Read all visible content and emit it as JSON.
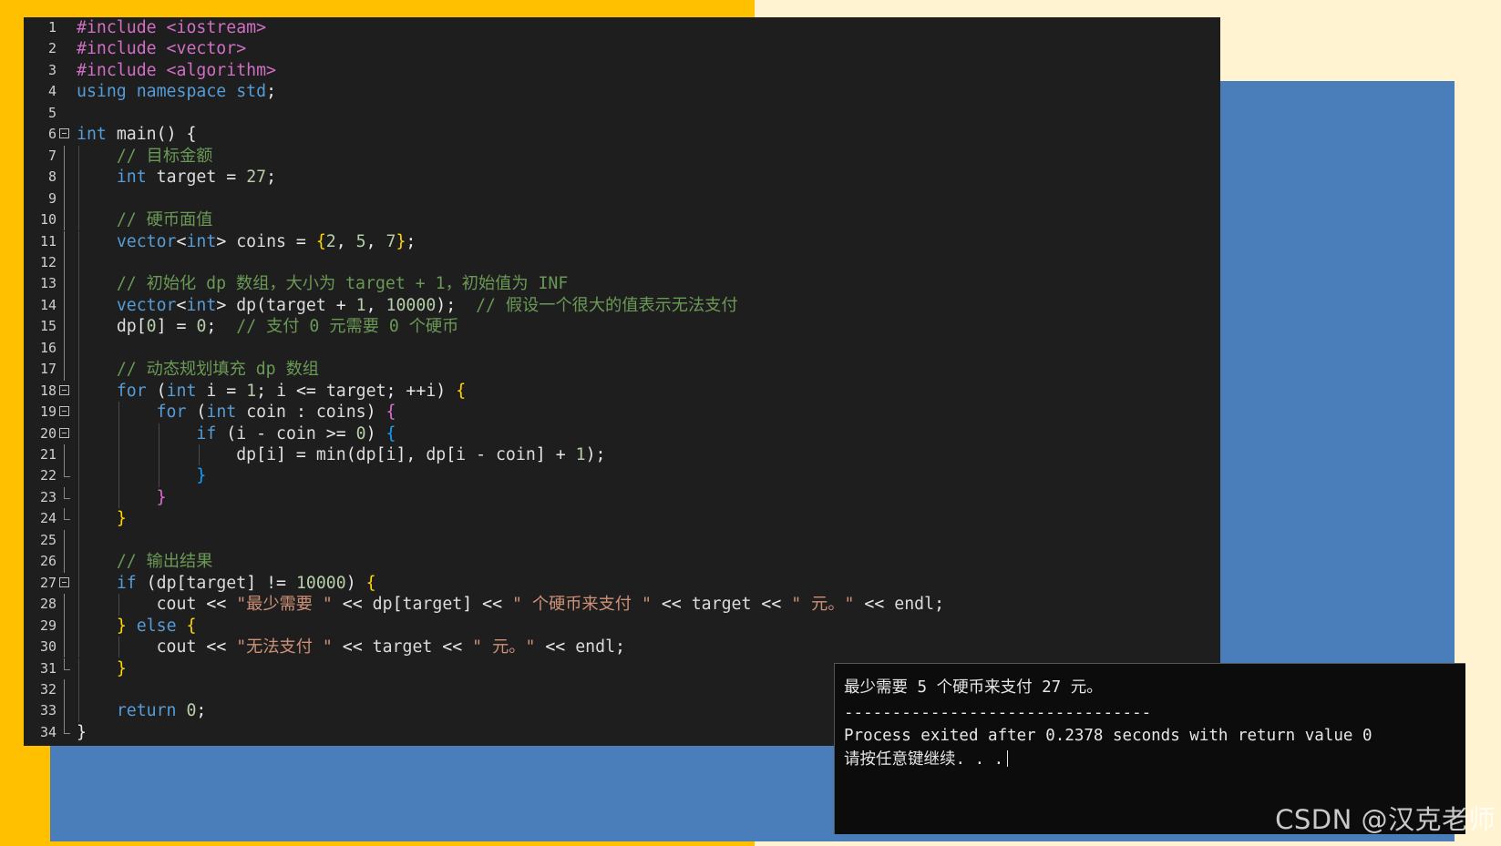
{
  "editor": {
    "lines": [
      {
        "num": "1",
        "html": "<span class=\"pp\">#include &lt;iostream&gt;</span>"
      },
      {
        "num": "2",
        "html": "<span class=\"pp\">#include &lt;vector&gt;</span>"
      },
      {
        "num": "3",
        "html": "<span class=\"pp\">#include &lt;algorithm&gt;</span>"
      },
      {
        "num": "4",
        "html": "<span class=\"kw\">using namespace</span> <span class=\"kw\">std</span>;"
      },
      {
        "num": "5",
        "html": ""
      },
      {
        "num": "6",
        "html": "<span class=\"kw\">int</span> <span class=\"id\">main</span>() {"
      },
      {
        "num": "7",
        "html": "    <span class=\"cm\">// 目标金额</span>"
      },
      {
        "num": "8",
        "html": "    <span class=\"kw\">int</span> <span class=\"id\">target</span> = <span class=\"num\">27</span>;"
      },
      {
        "num": "9",
        "html": ""
      },
      {
        "num": "10",
        "html": "    <span class=\"cm\">// 硬币面值</span>"
      },
      {
        "num": "11",
        "html": "    <span class=\"kw\">vector</span>&lt;<span class=\"kw\">int</span>&gt; <span class=\"id\">coins</span> = <span class=\"br\">{</span><span class=\"num\">2</span>, <span class=\"num\">5</span>, <span class=\"num\">7</span><span class=\"br\">}</span>;"
      },
      {
        "num": "12",
        "html": ""
      },
      {
        "num": "13",
        "html": "    <span class=\"cm\">// 初始化 dp 数组，大小为 target + 1，初始值为 INF</span>"
      },
      {
        "num": "14",
        "html": "    <span class=\"kw\">vector</span>&lt;<span class=\"kw\">int</span>&gt; <span class=\"id\">dp</span>(<span class=\"id\">target</span> + <span class=\"num\">1</span>, <span class=\"num\">10000</span>);  <span class=\"cm\">// 假设一个很大的值表示无法支付</span>"
      },
      {
        "num": "15",
        "html": "    <span class=\"id\">dp</span>[<span class=\"num\">0</span>] = <span class=\"num\">0</span>;  <span class=\"cm\">// 支付 0 元需要 0 个硬币</span>"
      },
      {
        "num": "16",
        "html": ""
      },
      {
        "num": "17",
        "html": "    <span class=\"cm\">// 动态规划填充 dp 数组</span>"
      },
      {
        "num": "18",
        "html": "    <span class=\"kw\">for</span> (<span class=\"kw\">int</span> <span class=\"id\">i</span> = <span class=\"num\">1</span>; <span class=\"id\">i</span> &lt;= <span class=\"id\">target</span>; ++<span class=\"id\">i</span>) <span class=\"br\">{</span>"
      },
      {
        "num": "19",
        "html": "        <span class=\"kw\">for</span> (<span class=\"kw\">int</span> <span class=\"id\">coin</span> : <span class=\"id\">coins</span>) <span class=\"br2\">{</span>"
      },
      {
        "num": "20",
        "html": "            <span class=\"kw\">if</span> (<span class=\"id\">i</span> - <span class=\"id\">coin</span> &gt;= <span class=\"num\">0</span>) <span class=\"br3\">{</span>"
      },
      {
        "num": "21",
        "html": "                <span class=\"id\">dp</span>[<span class=\"id\">i</span>] = <span class=\"id\">min</span>(<span class=\"id\">dp</span>[<span class=\"id\">i</span>], <span class=\"id\">dp</span>[<span class=\"id\">i</span> - <span class=\"id\">coin</span>] + <span class=\"num\">1</span>);"
      },
      {
        "num": "22",
        "html": "            <span class=\"br3\">}</span>"
      },
      {
        "num": "23",
        "html": "        <span class=\"br2\">}</span>"
      },
      {
        "num": "24",
        "html": "    <span class=\"br\">}</span>"
      },
      {
        "num": "25",
        "html": ""
      },
      {
        "num": "26",
        "html": "    <span class=\"cm\">// 输出结果</span>"
      },
      {
        "num": "27",
        "html": "    <span class=\"kw\">if</span> (<span class=\"id\">dp</span>[<span class=\"id\">target</span>] != <span class=\"num\">10000</span>) <span class=\"br\">{</span>"
      },
      {
        "num": "28",
        "html": "        <span class=\"id\">cout</span> &lt;&lt; <span class=\"str\">\"最少需要 \"</span> &lt;&lt; <span class=\"id\">dp</span>[<span class=\"id\">target</span>] &lt;&lt; <span class=\"str\">\" 个硬币来支付 \"</span> &lt;&lt; <span class=\"id\">target</span> &lt;&lt; <span class=\"str\">\" 元。\"</span> &lt;&lt; <span class=\"id\">endl</span>;"
      },
      {
        "num": "29",
        "html": "    <span class=\"br\">}</span> <span class=\"kw\">else</span> <span class=\"br\">{</span>"
      },
      {
        "num": "30",
        "html": "        <span class=\"id\">cout</span> &lt;&lt; <span class=\"str\">\"无法支付 \"</span> &lt;&lt; <span class=\"id\">target</span> &lt;&lt; <span class=\"str\">\" 元。\"</span> &lt;&lt; <span class=\"id\">endl</span>;"
      },
      {
        "num": "31",
        "html": "    <span class=\"br\">}</span>"
      },
      {
        "num": "32",
        "html": ""
      },
      {
        "num": "33",
        "html": "    <span class=\"kw\">return</span> <span class=\"num\">0</span>;"
      },
      {
        "num": "34",
        "html": "}"
      }
    ]
  },
  "console": {
    "result_line": "最少需要 5 个硬币来支付 27 元。",
    "separator": "--------------------------------",
    "process_line": "Process exited after 0.2378 seconds with return value 0",
    "prompt_line": "请按任意键继续. . ."
  },
  "watermark": "CSDN @汉克老师",
  "colors": {
    "accent_yellow": "#ffc000",
    "accent_blue": "#4a7ebb",
    "editor_bg": "#1e1e1e"
  }
}
